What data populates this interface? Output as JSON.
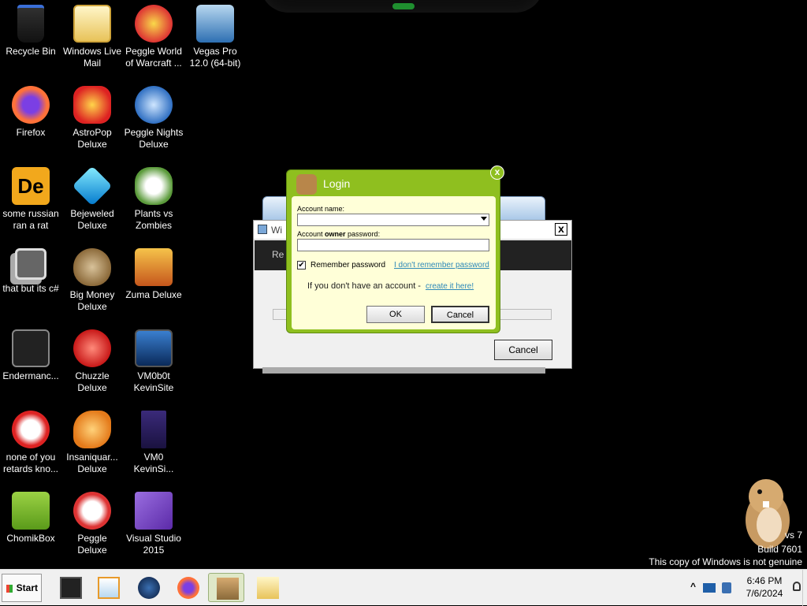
{
  "desktop": {
    "icons": [
      {
        "label": "Recycle Bin",
        "icon": "recycle-bin-icon"
      },
      {
        "label": "Windows Live Mail",
        "icon": "mail-icon"
      },
      {
        "label": "Peggle World of Warcraft ...",
        "icon": "peggle-icon"
      },
      {
        "label": "Vegas Pro 12.0 (64-bit)",
        "icon": "vegas-icon"
      },
      {
        "label": "Firefox",
        "icon": "firefox-icon"
      },
      {
        "label": "AstroPop Deluxe",
        "icon": "astropop-icon"
      },
      {
        "label": "Peggle Nights Deluxe",
        "icon": "peggle-nights-icon"
      },
      {
        "label": "some russian ran a rat",
        "icon": "de-icon"
      },
      {
        "label": "Bejeweled Deluxe",
        "icon": "gem-icon"
      },
      {
        "label": "Plants vs Zombies",
        "icon": "plants-icon"
      },
      {
        "label": "that but its c#",
        "icon": "windows-stack-icon"
      },
      {
        "label": "Big Money Deluxe",
        "icon": "money-bag-icon"
      },
      {
        "label": "Zuma Deluxe",
        "icon": "zuma-icon"
      },
      {
        "label": "Endermanc...",
        "icon": "terminal-icon"
      },
      {
        "label": "Chuzzle Deluxe",
        "icon": "chuzzle-icon"
      },
      {
        "label": "VM0b0t KevinSite",
        "icon": "vm-screen-icon"
      },
      {
        "label": "none of you retards kno...",
        "icon": "dragon-icon"
      },
      {
        "label": "Insaniquar... Deluxe",
        "icon": "fish-icon"
      },
      {
        "label": "VM0 KevinSi...",
        "icon": "firefox-file-icon"
      },
      {
        "label": "ChomikBox",
        "icon": "chomikbox-icon"
      },
      {
        "label": "Peggle Deluxe",
        "icon": "peggle-deluxe-icon"
      },
      {
        "label": "Visual Studio 2015",
        "icon": "visual-studio-icon"
      }
    ]
  },
  "bg_window": {
    "title": "Wi",
    "dark_text": "Re",
    "cancel_label": "Cancel",
    "close_label": "x"
  },
  "login": {
    "title": "Login",
    "close_label": "x",
    "account_name_label": "Account name:",
    "account_name_value": "",
    "password_label_pre": "Account ",
    "password_label_bold": "owner",
    "password_label_post": " password:",
    "password_value": "",
    "remember_label": "Remember password",
    "remember_checked": "✔",
    "forgot_link": "I don't remember password",
    "no_account_text": "If you don't have an account - ",
    "create_link": "create it here!",
    "ok_label": "OK",
    "cancel_label": "Cancel"
  },
  "watermark": {
    "line1": "vs 7",
    "line2": "Build 7601",
    "line3": "This copy of Windows is not genuine"
  },
  "taskbar": {
    "start_label": "Start",
    "buttons": [
      {
        "icon": "monitor-icon"
      },
      {
        "icon": "media-player-icon"
      },
      {
        "icon": "globe-icon"
      },
      {
        "icon": "firefox-icon"
      },
      {
        "icon": "chomikbox-icon"
      },
      {
        "icon": "mail-icon"
      }
    ],
    "tray_chevron": "^",
    "clock_time": "6:46 PM",
    "clock_date": "7/6/2024"
  }
}
